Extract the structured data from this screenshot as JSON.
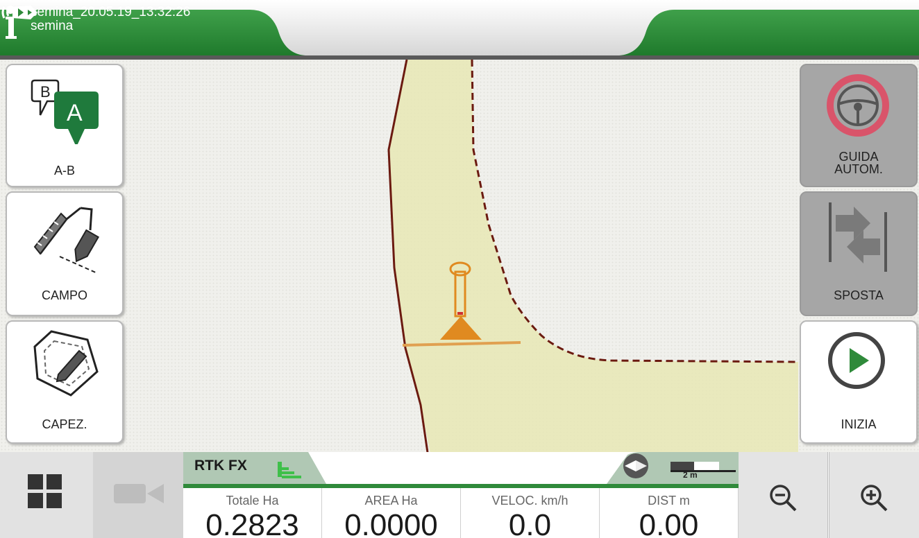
{
  "header": {
    "job_name": "semina_20.05.19_13:32:26",
    "job_type": "semina",
    "info_icon": "info-icon",
    "signal_icon": "radar-signal-icon"
  },
  "left_buttons": [
    {
      "label": "A-B",
      "icon": "ab-line-icon"
    },
    {
      "label": "CAMPO",
      "icon": "field-draw-icon"
    },
    {
      "label": "CAPEZ.",
      "icon": "headland-icon"
    }
  ],
  "right_buttons": [
    {
      "label_line1": "GUIDA",
      "label_line2": "AUTOM.",
      "icon": "steering-wheel-icon",
      "enabled": false
    },
    {
      "label": "SPOSTA",
      "icon": "shift-arrows-icon",
      "enabled": false
    },
    {
      "label": "INIZIA",
      "icon": "play-icon",
      "enabled": true
    }
  ],
  "status": {
    "gps_mode": "RTK FX",
    "gps_signal_icon": "signal-bars-icon",
    "scale_label": "2 m"
  },
  "readouts": [
    {
      "label": "Totale Ha",
      "value": "0.2823"
    },
    {
      "label": "AREA Ha",
      "value": "0.0000"
    },
    {
      "label": "VELOC. km/h",
      "value": "0.0"
    },
    {
      "label": "DIST m",
      "value": "0.00"
    }
  ],
  "colors": {
    "brand_green": "#2f8a3a",
    "field_fill": "#e8e8b8",
    "boundary": "#6b1a10",
    "tractor": "#e08a20",
    "guidance_off": "#d9546a"
  }
}
